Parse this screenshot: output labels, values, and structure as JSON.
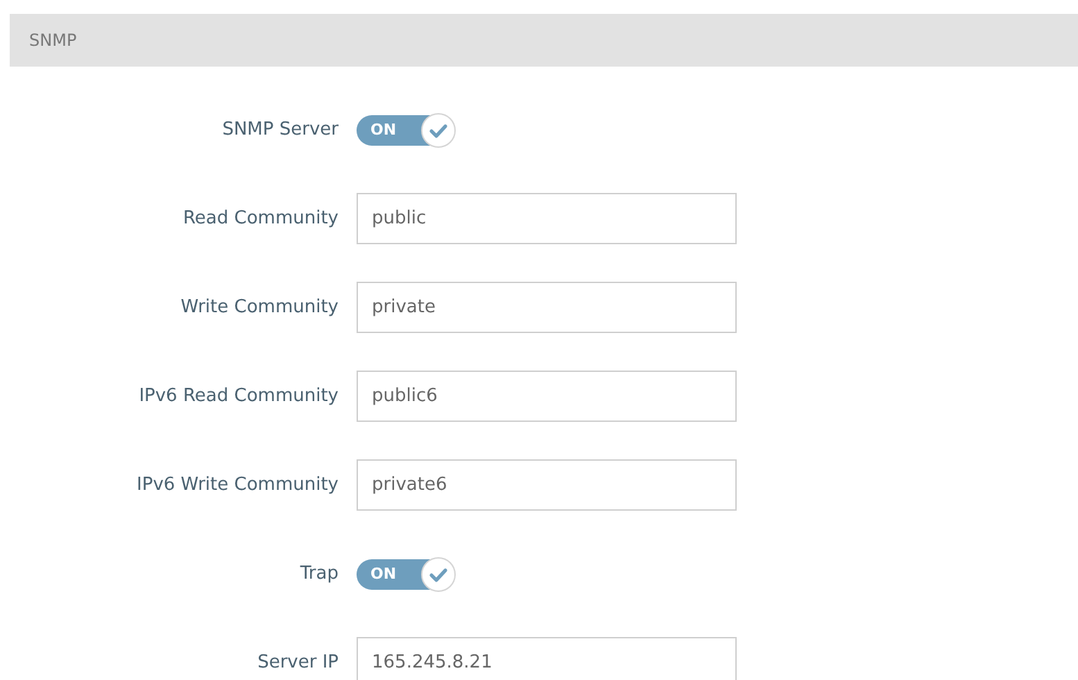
{
  "section": {
    "title": "SNMP"
  },
  "settings": [
    {
      "kind": "toggle",
      "label": "SNMP Server",
      "text": "ON",
      "on": true
    },
    {
      "kind": "field",
      "label": "Read Community",
      "value": "public"
    },
    {
      "kind": "field",
      "label": "Write Community",
      "value": "private"
    },
    {
      "kind": "field",
      "label": "IPv6 Read Community",
      "value": "public6"
    },
    {
      "kind": "field",
      "label": "IPv6 Write Community",
      "value": "private6"
    },
    {
      "kind": "toggle",
      "label": "Trap",
      "text": "ON",
      "on": true
    },
    {
      "kind": "field",
      "label": "Server IP",
      "value": "165.245.8.21"
    }
  ]
}
